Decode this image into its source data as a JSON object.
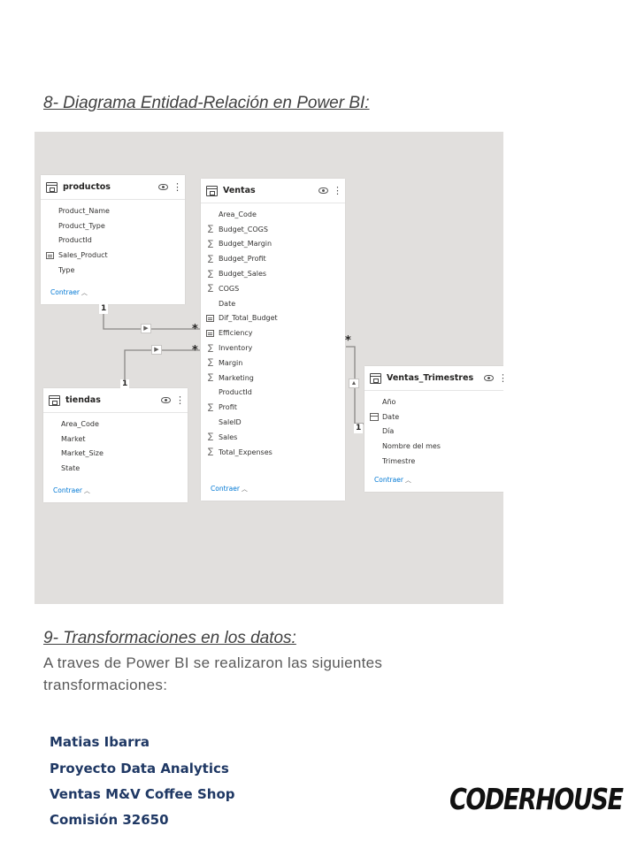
{
  "section8": {
    "heading": "8- Diagrama Entidad-Relación en Power BI:"
  },
  "diagram": {
    "tables": {
      "productos": {
        "title": "productos",
        "fields": [
          {
            "name": "Product_Name",
            "icon": "none"
          },
          {
            "name": "Product_Type",
            "icon": "none"
          },
          {
            "name": "ProductId",
            "icon": "none"
          },
          {
            "name": "Sales_Product",
            "icon": "calculated-icon"
          },
          {
            "name": "Type",
            "icon": "none"
          }
        ],
        "collapse": "Contraer"
      },
      "ventas": {
        "title": "Ventas",
        "fields": [
          {
            "name": "Area_Code",
            "icon": "none"
          },
          {
            "name": "Budget_COGS",
            "icon": "sigma-icon"
          },
          {
            "name": "Budget_Margin",
            "icon": "sigma-icon"
          },
          {
            "name": "Budget_Profit",
            "icon": "sigma-icon"
          },
          {
            "name": "Budget_Sales",
            "icon": "sigma-icon"
          },
          {
            "name": "COGS",
            "icon": "sigma-icon"
          },
          {
            "name": "Date",
            "icon": "none"
          },
          {
            "name": "Dif_Total_Budget",
            "icon": "calculated-icon"
          },
          {
            "name": "Efficiency",
            "icon": "calculated-icon"
          },
          {
            "name": "Inventory",
            "icon": "sigma-icon"
          },
          {
            "name": "Margin",
            "icon": "sigma-icon"
          },
          {
            "name": "Marketing",
            "icon": "sigma-icon"
          },
          {
            "name": "ProductId",
            "icon": "none"
          },
          {
            "name": "Profit",
            "icon": "sigma-icon"
          },
          {
            "name": "SaleID",
            "icon": "none"
          },
          {
            "name": "Sales",
            "icon": "sigma-icon"
          },
          {
            "name": "Total_Expenses",
            "icon": "sigma-icon"
          }
        ],
        "collapse": "Contraer"
      },
      "tiendas": {
        "title": "tiendas",
        "fields": [
          {
            "name": "Area_Code",
            "icon": "none"
          },
          {
            "name": "Market",
            "icon": "none"
          },
          {
            "name": "Market_Size",
            "icon": "none"
          },
          {
            "name": "State",
            "icon": "none"
          }
        ],
        "collapse": "Contraer"
      },
      "ventas_trimestres": {
        "title": "Ventas_Trimestres",
        "fields": [
          {
            "name": "Año",
            "icon": "none"
          },
          {
            "name": "Date",
            "icon": "calendar-icon"
          },
          {
            "name": "Día",
            "icon": "none"
          },
          {
            "name": "Nombre del mes",
            "icon": "none"
          },
          {
            "name": "Trimestre",
            "icon": "none"
          }
        ],
        "collapse": "Contraer"
      }
    },
    "relationships": {
      "one": "1",
      "many": "*"
    }
  },
  "section9": {
    "heading": "9- Transformaciones en los datos:",
    "paragraph": "A traves de Power BI se realizaron las siguientes transformaciones:"
  },
  "footer": {
    "author": "Matias Ibarra",
    "project": "Proyecto Data Analytics",
    "subject": "Ventas M&V Coffee Shop",
    "commission": "Comisión 32650",
    "logo": "CODERHOUSE"
  }
}
